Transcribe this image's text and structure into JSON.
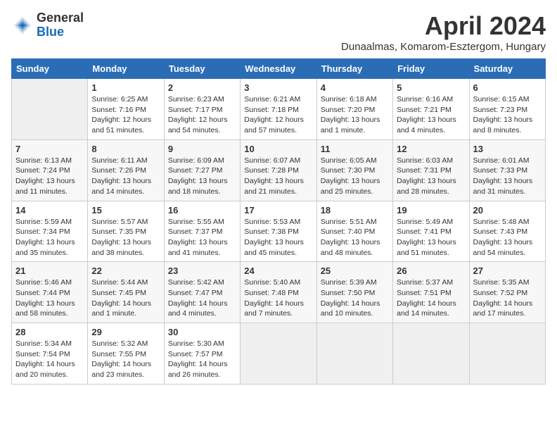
{
  "header": {
    "logo_general": "General",
    "logo_blue": "Blue",
    "month": "April 2024",
    "location": "Dunaalmas, Komarom-Esztergom, Hungary"
  },
  "weekdays": [
    "Sunday",
    "Monday",
    "Tuesday",
    "Wednesday",
    "Thursday",
    "Friday",
    "Saturday"
  ],
  "weeks": [
    [
      {
        "day": "",
        "info": ""
      },
      {
        "day": "1",
        "info": "Sunrise: 6:25 AM\nSunset: 7:16 PM\nDaylight: 12 hours\nand 51 minutes."
      },
      {
        "day": "2",
        "info": "Sunrise: 6:23 AM\nSunset: 7:17 PM\nDaylight: 12 hours\nand 54 minutes."
      },
      {
        "day": "3",
        "info": "Sunrise: 6:21 AM\nSunset: 7:18 PM\nDaylight: 12 hours\nand 57 minutes."
      },
      {
        "day": "4",
        "info": "Sunrise: 6:18 AM\nSunset: 7:20 PM\nDaylight: 13 hours\nand 1 minute."
      },
      {
        "day": "5",
        "info": "Sunrise: 6:16 AM\nSunset: 7:21 PM\nDaylight: 13 hours\nand 4 minutes."
      },
      {
        "day": "6",
        "info": "Sunrise: 6:15 AM\nSunset: 7:23 PM\nDaylight: 13 hours\nand 8 minutes."
      }
    ],
    [
      {
        "day": "7",
        "info": "Sunrise: 6:13 AM\nSunset: 7:24 PM\nDaylight: 13 hours\nand 11 minutes."
      },
      {
        "day": "8",
        "info": "Sunrise: 6:11 AM\nSunset: 7:26 PM\nDaylight: 13 hours\nand 14 minutes."
      },
      {
        "day": "9",
        "info": "Sunrise: 6:09 AM\nSunset: 7:27 PM\nDaylight: 13 hours\nand 18 minutes."
      },
      {
        "day": "10",
        "info": "Sunrise: 6:07 AM\nSunset: 7:28 PM\nDaylight: 13 hours\nand 21 minutes."
      },
      {
        "day": "11",
        "info": "Sunrise: 6:05 AM\nSunset: 7:30 PM\nDaylight: 13 hours\nand 25 minutes."
      },
      {
        "day": "12",
        "info": "Sunrise: 6:03 AM\nSunset: 7:31 PM\nDaylight: 13 hours\nand 28 minutes."
      },
      {
        "day": "13",
        "info": "Sunrise: 6:01 AM\nSunset: 7:33 PM\nDaylight: 13 hours\nand 31 minutes."
      }
    ],
    [
      {
        "day": "14",
        "info": "Sunrise: 5:59 AM\nSunset: 7:34 PM\nDaylight: 13 hours\nand 35 minutes."
      },
      {
        "day": "15",
        "info": "Sunrise: 5:57 AM\nSunset: 7:35 PM\nDaylight: 13 hours\nand 38 minutes."
      },
      {
        "day": "16",
        "info": "Sunrise: 5:55 AM\nSunset: 7:37 PM\nDaylight: 13 hours\nand 41 minutes."
      },
      {
        "day": "17",
        "info": "Sunrise: 5:53 AM\nSunset: 7:38 PM\nDaylight: 13 hours\nand 45 minutes."
      },
      {
        "day": "18",
        "info": "Sunrise: 5:51 AM\nSunset: 7:40 PM\nDaylight: 13 hours\nand 48 minutes."
      },
      {
        "day": "19",
        "info": "Sunrise: 5:49 AM\nSunset: 7:41 PM\nDaylight: 13 hours\nand 51 minutes."
      },
      {
        "day": "20",
        "info": "Sunrise: 5:48 AM\nSunset: 7:43 PM\nDaylight: 13 hours\nand 54 minutes."
      }
    ],
    [
      {
        "day": "21",
        "info": "Sunrise: 5:46 AM\nSunset: 7:44 PM\nDaylight: 13 hours\nand 58 minutes."
      },
      {
        "day": "22",
        "info": "Sunrise: 5:44 AM\nSunset: 7:45 PM\nDaylight: 14 hours\nand 1 minute."
      },
      {
        "day": "23",
        "info": "Sunrise: 5:42 AM\nSunset: 7:47 PM\nDaylight: 14 hours\nand 4 minutes."
      },
      {
        "day": "24",
        "info": "Sunrise: 5:40 AM\nSunset: 7:48 PM\nDaylight: 14 hours\nand 7 minutes."
      },
      {
        "day": "25",
        "info": "Sunrise: 5:39 AM\nSunset: 7:50 PM\nDaylight: 14 hours\nand 10 minutes."
      },
      {
        "day": "26",
        "info": "Sunrise: 5:37 AM\nSunset: 7:51 PM\nDaylight: 14 hours\nand 14 minutes."
      },
      {
        "day": "27",
        "info": "Sunrise: 5:35 AM\nSunset: 7:52 PM\nDaylight: 14 hours\nand 17 minutes."
      }
    ],
    [
      {
        "day": "28",
        "info": "Sunrise: 5:34 AM\nSunset: 7:54 PM\nDaylight: 14 hours\nand 20 minutes."
      },
      {
        "day": "29",
        "info": "Sunrise: 5:32 AM\nSunset: 7:55 PM\nDaylight: 14 hours\nand 23 minutes."
      },
      {
        "day": "30",
        "info": "Sunrise: 5:30 AM\nSunset: 7:57 PM\nDaylight: 14 hours\nand 26 minutes."
      },
      {
        "day": "",
        "info": ""
      },
      {
        "day": "",
        "info": ""
      },
      {
        "day": "",
        "info": ""
      },
      {
        "day": "",
        "info": ""
      }
    ]
  ]
}
